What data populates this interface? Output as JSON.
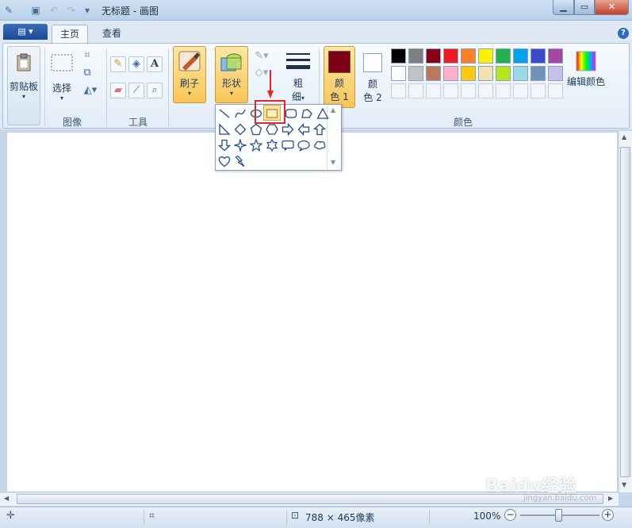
{
  "window": {
    "title": "无标题 - 画图",
    "minimize": "▁",
    "maximize": "▭",
    "close": "✕"
  },
  "tabs": {
    "app_menu": "▤ ▾",
    "home": "主页",
    "view": "查看",
    "help": "?"
  },
  "ribbon": {
    "clipboard": {
      "label": "剪贴板",
      "arrow": "▾"
    },
    "image": {
      "select_label": "选择",
      "select_arrow": "▾",
      "group_label": "图像"
    },
    "tools": {
      "group_label": "工具",
      "text_icon": "A"
    },
    "brushes": {
      "label": "刷子",
      "arrow": "▾"
    },
    "shapes": {
      "label": "形状",
      "arrow": "▾"
    },
    "size": {
      "label_line1": "粗",
      "label_line2": "细",
      "arrow": "▾"
    },
    "color1": {
      "line1": "颜",
      "line2": "色 1",
      "color": "#7f0019"
    },
    "color2": {
      "line1": "颜",
      "line2": "色 2",
      "color": "#ffffff"
    },
    "edit_colors": "编辑颜色",
    "colors_group_label": "颜色"
  },
  "palette": {
    "row1": [
      "#000000",
      "#7f7f7f",
      "#880015",
      "#ed1c24",
      "#ff7f27",
      "#fff200",
      "#22b14c",
      "#00a2e8",
      "#3f48cc",
      "#a349a4"
    ],
    "row2": [
      "#ffffff",
      "#c3c3c3",
      "#b97a57",
      "#ffaec9",
      "#ffc90e",
      "#efe4b0",
      "#b5e61d",
      "#99d9ea",
      "#7092be",
      "#c8bfe7"
    ]
  },
  "shapes_menu": {
    "items": [
      "line",
      "curve",
      "oval",
      "rectangle",
      "rounded-rectangle",
      "polygon",
      "triangle",
      "right-triangle",
      "diamond",
      "pentagon",
      "hexagon",
      "right-arrow",
      "left-arrow",
      "up-arrow",
      "down-arrow",
      "four-point-star",
      "five-point-star",
      "six-point-star",
      "rounded-callout",
      "oval-callout",
      "cloud-callout",
      "heart",
      "lightning"
    ],
    "selected": "rectangle"
  },
  "status": {
    "canvas_size": "788 × 465像素",
    "zoom": "100%",
    "zoom_out": "−",
    "zoom_in": "+"
  },
  "watermark": {
    "text": "Baidu经验",
    "sub": "jingyan.baidu.com"
  }
}
